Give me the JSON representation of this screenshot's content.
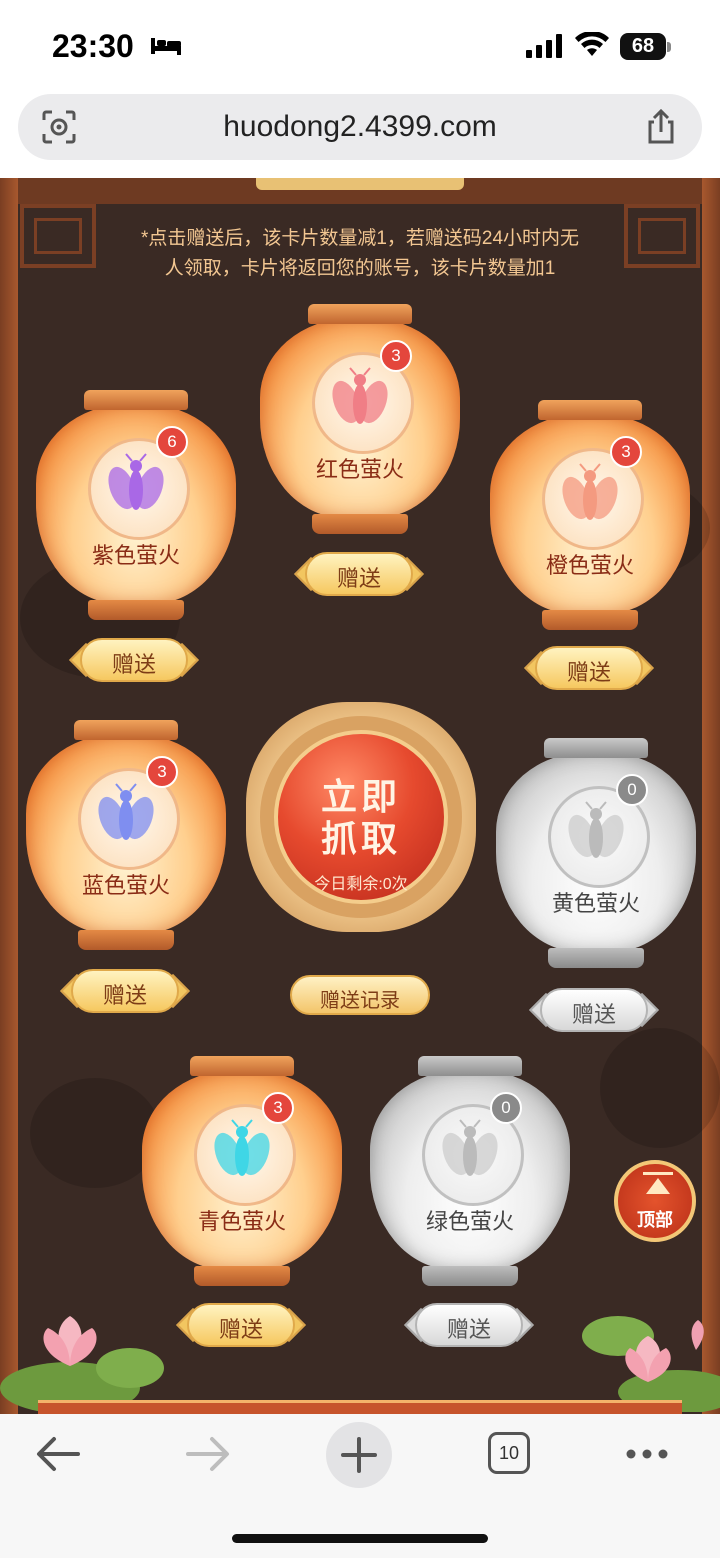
{
  "statusbar": {
    "time": "23:30",
    "battery": "68"
  },
  "browser": {
    "url": "huodong2.4399.com",
    "tab_count": "10"
  },
  "notice": {
    "line1": "*点击赠送后，该卡片数量减1，若赠送码24小时内无",
    "line2": "人领取，卡片将返回您的账号，该卡片数量加1"
  },
  "lanterns": [
    {
      "name": "紫色萤火",
      "count": "6",
      "give": "赠送",
      "color": "#a968e6",
      "active": true
    },
    {
      "name": "红色萤火",
      "count": "3",
      "give": "赠送",
      "color": "#f07e86",
      "active": true
    },
    {
      "name": "橙色萤火",
      "count": "3",
      "give": "赠送",
      "color": "#f49a80",
      "active": true
    },
    {
      "name": "蓝色萤火",
      "count": "3",
      "give": "赠送",
      "color": "#7f8ef0",
      "active": true
    },
    {
      "name": "黄色萤火",
      "count": "0",
      "give": "赠送",
      "color": "#cccccc",
      "active": false
    },
    {
      "name": "青色萤火",
      "count": "3",
      "give": "赠送",
      "color": "#3fd6e6",
      "active": true
    },
    {
      "name": "绿色萤火",
      "count": "0",
      "give": "赠送",
      "color": "#cccccc",
      "active": false
    }
  ],
  "grab": {
    "line1": "立即",
    "line2": "抓取",
    "remaining": "今日剩余:0次"
  },
  "record": {
    "label": "赠送记录"
  },
  "top": {
    "label": "顶部"
  }
}
